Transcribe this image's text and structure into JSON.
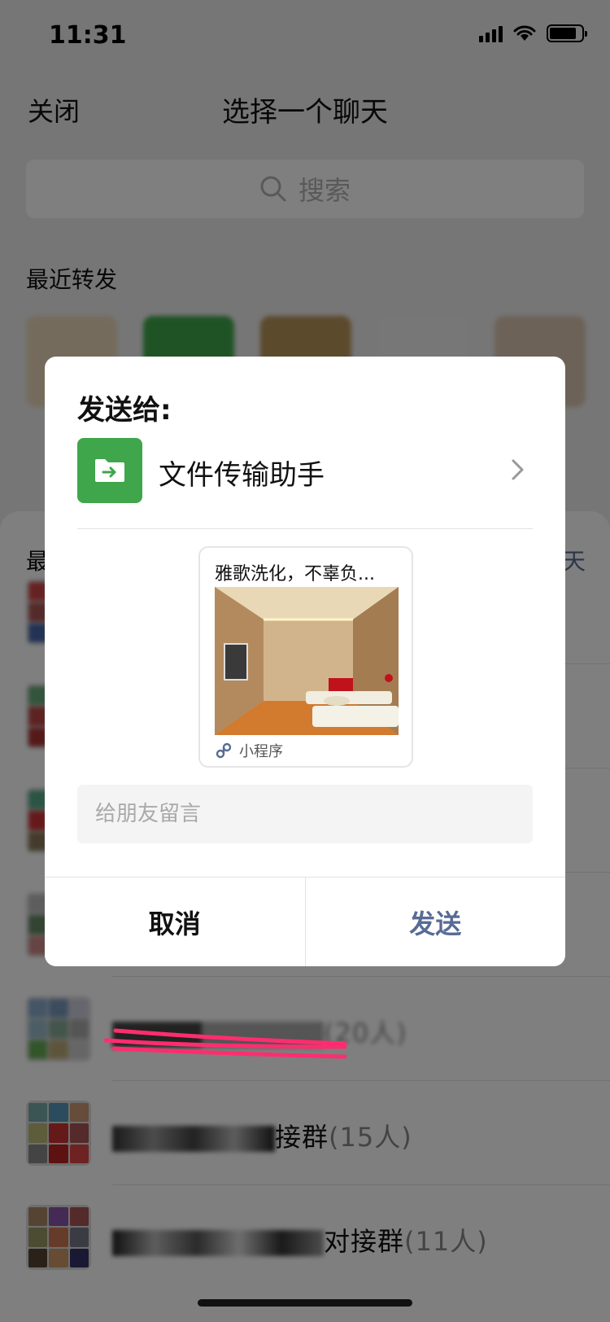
{
  "status": {
    "time": "11:31"
  },
  "nav": {
    "close_label": "关闭",
    "title": "选择一个聊天"
  },
  "search": {
    "placeholder": "搜索"
  },
  "recent_forward": {
    "title": "最近转发",
    "avatar_colors": [
      "#e8d7b8",
      "#3fa64b",
      "#b8945a",
      "#eeeeee",
      "#d8c4b0"
    ]
  },
  "chat_list": {
    "section_title": "最近聊天",
    "more_label": "创建新聊天",
    "rows": [
      {
        "name": "",
        "count": ""
      },
      {
        "name": "",
        "count": ""
      },
      {
        "name": "",
        "count": ""
      },
      {
        "name": "",
        "count": ""
      },
      {
        "name": "",
        "count": "(20人)"
      },
      {
        "name": "接群",
        "count": "(15人)"
      },
      {
        "name": "对接群",
        "count": "(11人)"
      }
    ]
  },
  "dialog": {
    "send_to_label": "发送给:",
    "recipient_name": "文件传输助手",
    "miniprogram": {
      "title": "雅歌洗化，不辜负...",
      "source_label": "小程序"
    },
    "message_placeholder": "给朋友留言",
    "cancel_label": "取消",
    "send_label": "发送"
  },
  "colors": {
    "accent_link": "#576b95",
    "file_helper_green": "#3fa64b",
    "scribble": "#ff2d6f"
  }
}
